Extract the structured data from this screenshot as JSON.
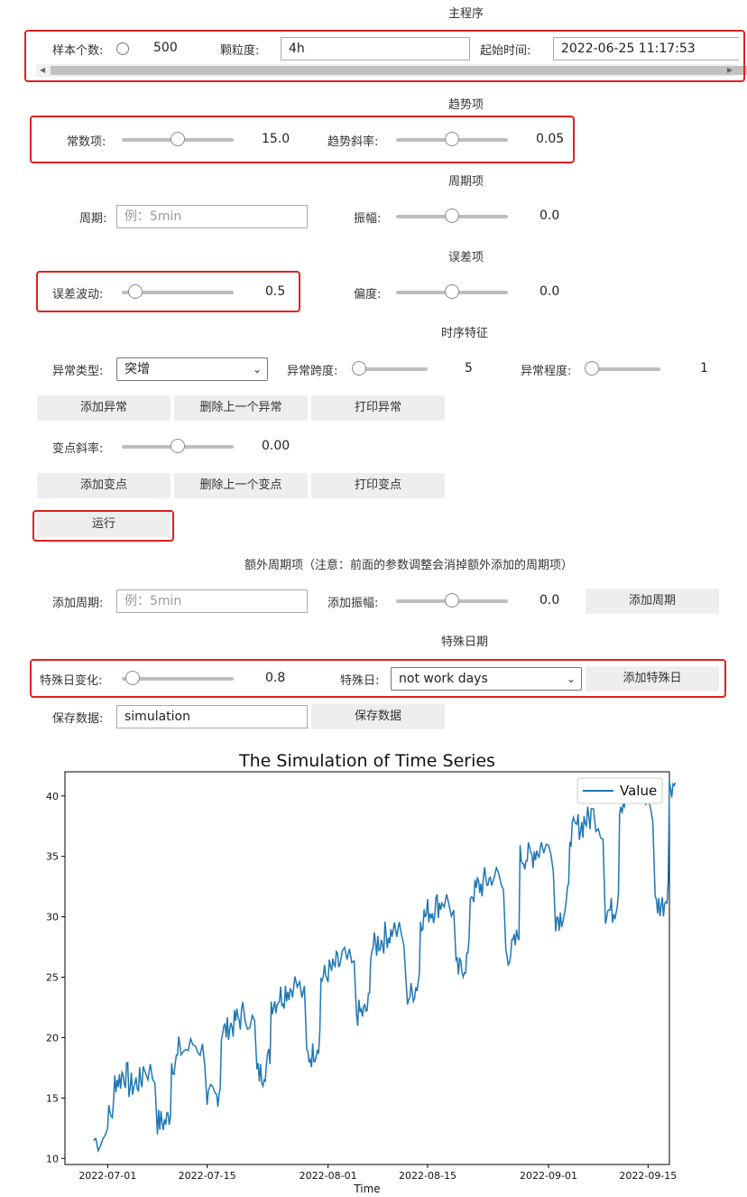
{
  "sections": {
    "main": "主程序",
    "trend": "趋势项",
    "period": "周期项",
    "error": "误差项",
    "features": "时序特征",
    "extra_period": "额外周期项（注意：前面的参数调整会消掉额外添加的周期项）",
    "special_day": "特殊日期"
  },
  "main": {
    "samples_label": "样本个数:",
    "samples_value": "500",
    "granularity_label": "颗粒度:",
    "granularity_value": "4h",
    "start_time_label": "起始时间:",
    "start_time_value": "2022-06-25 11:17:53"
  },
  "trend": {
    "constant_label": "常数项:",
    "constant_value": "15.0",
    "constant_pos": 0.5,
    "slope_label": "趋势斜率:",
    "slope_value": "0.05",
    "slope_pos": 0.5
  },
  "period": {
    "period_label": "周期:",
    "period_placeholder": "例：5min",
    "amp_label": "振幅:",
    "amp_value": "0.0",
    "amp_pos": 0.5
  },
  "error": {
    "label": "误差波动:",
    "value": "0.5",
    "pos": 0.12,
    "skew_label": "偏度:",
    "skew_value": "0.0",
    "skew_pos": 0.5
  },
  "features": {
    "anomaly_type_label": "异常类型:",
    "anomaly_type_value": "突增",
    "anomaly_span_label": "异常跨度:",
    "anomaly_span_value": "5",
    "anomaly_span_pos": 0.0,
    "anomaly_level_label": "异常程度:",
    "anomaly_level_value": "1",
    "anomaly_level_pos": 0.0,
    "add_anomaly": "添加异常",
    "delete_anomaly": "删除上一个异常",
    "print_anomaly": "打印异常",
    "change_slope_label": "变点斜率:",
    "change_slope_value": "0.00",
    "change_slope_pos": 0.5,
    "add_change": "添加变点",
    "delete_change": "删除上一个变点",
    "print_change": "打印变点",
    "run": "运行"
  },
  "extra_period": {
    "period_label": "添加周期:",
    "period_placeholder": "例：5min",
    "amp_label": "添加振幅:",
    "amp_value": "0.0",
    "amp_pos": 0.5,
    "add_button": "添加周期"
  },
  "special": {
    "change_label": "特殊日变化:",
    "change_value": "0.8",
    "change_pos": 0.1,
    "day_label": "特殊日:",
    "day_value": "not work days",
    "add_button": "添加特殊日"
  },
  "save": {
    "label": "保存数据:",
    "value": "simulation",
    "button": "保存数据"
  },
  "chart_data": {
    "type": "line",
    "title": "The Simulation of Time Series",
    "xlabel": "Time",
    "ylabel": "",
    "x_range": [
      "2022-06-25",
      "2022-09-18"
    ],
    "ylim": [
      9.5,
      42
    ],
    "x_ticks": [
      "2022-07-01",
      "2022-07-15",
      "2022-08-01",
      "2022-08-15",
      "2022-09-01",
      "2022-09-15"
    ],
    "y_ticks": [
      10,
      15,
      20,
      25,
      30,
      35,
      40
    ],
    "legend": "top-right",
    "grid": false,
    "series": [
      {
        "name": "Value",
        "color": "#1f77b4",
        "x": [
          "2022-06-29",
          "2022-07-01",
          "2022-07-02",
          "2022-07-03",
          "2022-07-04",
          "2022-07-05",
          "2022-07-06",
          "2022-07-08",
          "2022-07-09",
          "2022-07-10",
          "2022-07-11",
          "2022-07-13",
          "2022-07-15",
          "2022-07-16",
          "2022-07-17",
          "2022-07-18",
          "2022-07-19",
          "2022-07-20",
          "2022-07-22",
          "2022-07-23",
          "2022-07-24",
          "2022-07-25",
          "2022-07-26",
          "2022-07-27",
          "2022-07-29",
          "2022-07-30",
          "2022-07-31",
          "2022-08-01",
          "2022-08-02",
          "2022-08-03",
          "2022-08-05",
          "2022-08-06",
          "2022-08-07",
          "2022-08-08",
          "2022-08-09",
          "2022-08-10",
          "2022-08-12",
          "2022-08-13",
          "2022-08-14",
          "2022-08-15",
          "2022-08-16",
          "2022-08-17",
          "2022-08-19",
          "2022-08-20",
          "2022-08-21",
          "2022-08-22",
          "2022-08-23",
          "2022-08-24",
          "2022-08-26",
          "2022-08-27",
          "2022-08-28",
          "2022-08-29",
          "2022-08-30",
          "2022-08-31",
          "2022-09-02",
          "2022-09-03",
          "2022-09-04",
          "2022-09-05",
          "2022-09-06",
          "2022-09-07",
          "2022-09-09",
          "2022-09-10",
          "2022-09-11",
          "2022-09-12",
          "2022-09-13",
          "2022-09-14",
          "2022-09-16",
          "2022-09-17",
          "2022-09-18"
        ],
        "y": [
          11.5,
          13.5,
          16.5,
          17,
          16,
          16.3,
          17.5,
          13,
          13,
          18,
          19,
          19.5,
          15,
          15,
          20.5,
          21,
          21.5,
          22,
          17,
          17.5,
          23,
          23.5,
          24,
          24.5,
          18.5,
          19,
          25,
          25.5,
          26,
          26.5,
          22,
          22,
          27.5,
          28,
          28.5,
          29,
          23.5,
          24,
          30,
          30.5,
          31,
          31.5,
          25.5,
          26,
          32,
          32.5,
          33,
          33.5,
          27,
          27.5,
          35,
          35,
          35.5,
          36,
          30,
          30.5,
          37,
          37.5,
          38,
          38.5,
          30.5,
          30.5,
          39.5,
          40,
          40,
          40.5,
          31,
          31,
          41
        ]
      }
    ]
  }
}
